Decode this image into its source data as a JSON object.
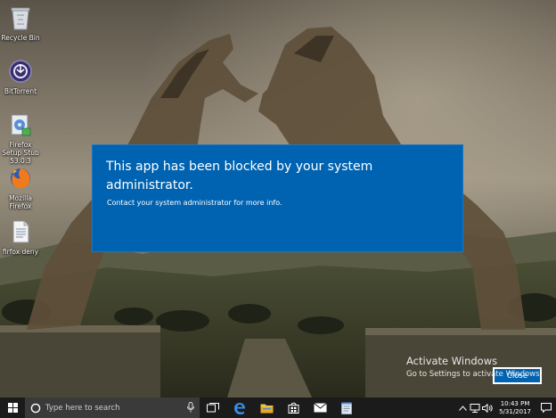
{
  "desktop": {
    "icons": [
      {
        "label": "Recycle Bin",
        "icon": "recycle-bin-icon"
      },
      {
        "label": "BitTorrent",
        "icon": "bittorrent-icon"
      },
      {
        "label": "Firefox Setup Stub 53.0.3",
        "icon": "installer-icon"
      },
      {
        "label": "Mozilla Firefox",
        "icon": "firefox-icon"
      },
      {
        "label": "firfox deny",
        "icon": "text-file-icon"
      }
    ]
  },
  "dialog": {
    "title": "This app has been blocked by your system administrator.",
    "message": "Contact your system administrator for more info.",
    "close_label": "Close",
    "accent": "#0063b1"
  },
  "watermark": {
    "line1": "Activate Windows",
    "line2": "Go to Settings to activate Windows."
  },
  "taskbar": {
    "search_placeholder": "Type here to search",
    "apps": [
      "task-view-icon",
      "edge-icon",
      "file-explorer-icon",
      "store-icon",
      "mail-icon",
      "notepad-icon"
    ],
    "clock_time": "10:43 PM",
    "clock_date": "5/31/2017"
  }
}
